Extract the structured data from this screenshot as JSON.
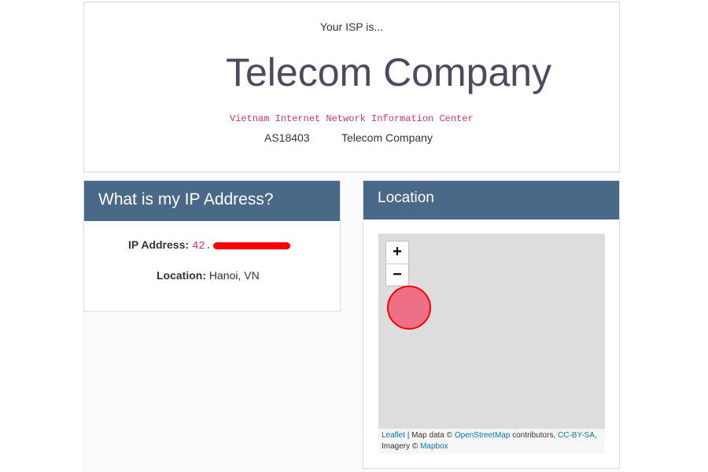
{
  "isp": {
    "lead": "Your ISP is...",
    "name": "Telecom Company",
    "org": "Vietnam Internet Network Information Center",
    "asn": "AS18403",
    "asn_name": "Telecom Company"
  },
  "ip_card": {
    "title": "What is my IP Address?",
    "ip_label": "IP Address:",
    "ip_value": "42.",
    "location_label": "Location:",
    "location_value": "Hanoi, VN"
  },
  "location_card": {
    "title": "Location",
    "zoom_in": "+",
    "zoom_out": "−",
    "attribution": {
      "leaflet": "Leaflet",
      "sep": " | Map data © ",
      "osm": "OpenStreetMap",
      "contributors": " contributors, ",
      "license": "CC-BY-SA",
      "imagery": ", Imagery © ",
      "mapbox": "Mapbox"
    }
  },
  "colors": {
    "header_bg": "#4a6888",
    "accent_code": "#d6336c",
    "marker_fill": "#ee7087",
    "marker_stroke": "#ff0000",
    "redaction": "#ff0000"
  }
}
